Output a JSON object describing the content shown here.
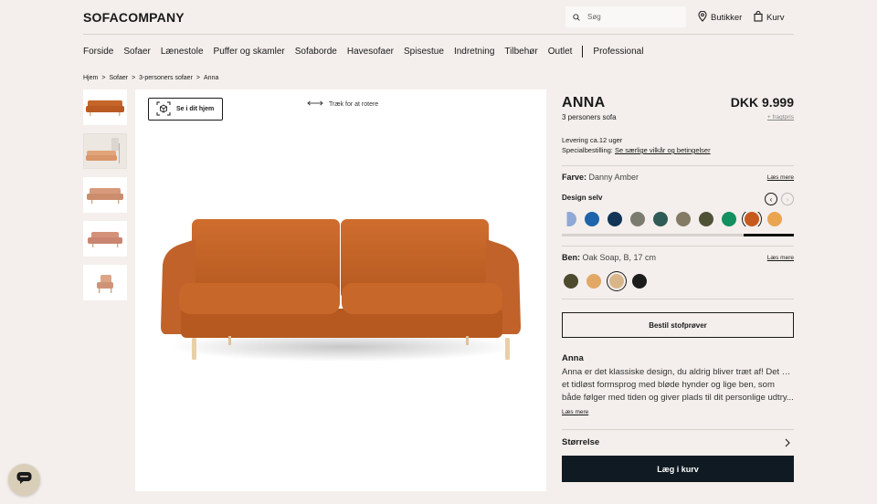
{
  "header": {
    "logo": "SOFACOMPANY",
    "search_placeholder": "Søg",
    "stores_label": "Butikker",
    "cart_label": "Kurv"
  },
  "nav": {
    "items": [
      "Forside",
      "Sofaer",
      "Lænestole",
      "Puffer og skamler",
      "Sofaborde",
      "Havesofaer",
      "Spisestue",
      "Indretning",
      "Tilbehør",
      "Outlet"
    ],
    "extra": "Professional"
  },
  "breadcrumb": [
    "Hjem",
    ">",
    "Sofaer",
    ">",
    "3-personers sofaer",
    ">",
    "Anna"
  ],
  "gallery": {
    "ar_button": "Se i dit hjem",
    "rotate_hint": "Træk for at rotere"
  },
  "product": {
    "name": "ANNA",
    "price": "DKK 9.999",
    "subtitle": "3 personers sofa",
    "freight": "+ fragtpris",
    "delivery": "Levering ca.12 uger",
    "special_label": "Specialbestilling:",
    "special_link": "Se særlige vilkår og betingelser",
    "color_label": "Farve:",
    "color_value": "Danny Amber",
    "read_more": "Læs mere",
    "design_label": "Design selv",
    "legs_label": "Ben:",
    "legs_value": "Oak Soap, B, 17 cm",
    "sample_button": "Bestil stofprøver",
    "desc_title": "Anna",
    "desc_lines": [
      "Anna er det klassiske design, du aldrig bliver træt af! Det har",
      "et tidløst formsprog med bløde hynder og lige ben, som",
      "både følger med tiden og giver plads til dit personlige udtry..."
    ],
    "desc_read_more": "Læs mere",
    "size_label": "Størrelse",
    "add_to_cart": "Læg i kurv"
  },
  "colors": {
    "fabric_swatches": [
      "#6b8fc8",
      "#1e64ab",
      "#123456",
      "#7c7b70",
      "#2f5a55",
      "#847b66",
      "#505236",
      "#129060",
      "#c65a1e",
      "#eaa550"
    ],
    "leg_swatches": [
      "#4d4a2e",
      "#e2a866",
      "#d9b68a",
      "#1c1c1c"
    ],
    "sofa": "#c6652a",
    "accent_dark": "#101a22"
  }
}
